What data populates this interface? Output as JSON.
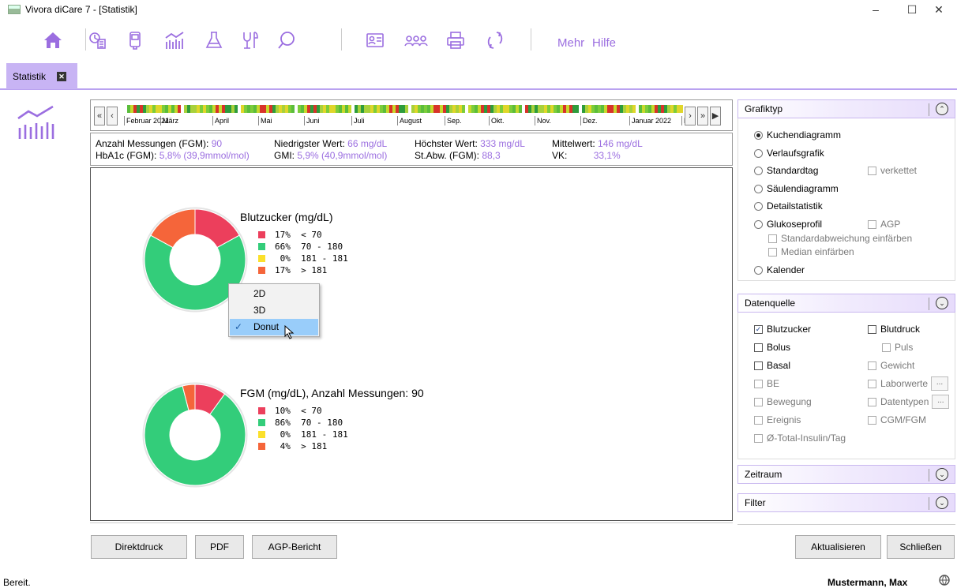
{
  "window": {
    "title": "Vivora diCare 7 - [Statistik]",
    "minimize": "–",
    "maximize": "☐",
    "close": "✕"
  },
  "toolbar": {
    "more_label": "Mehr",
    "help_label": "Hilfe"
  },
  "tab": {
    "label": "Statistik",
    "close": "✕"
  },
  "timeline": {
    "btn_first": "«",
    "btn_prev": "‹",
    "btn_next": "›",
    "btn_last": "»",
    "btn_play": "▶",
    "months": [
      "Februar 2021",
      "März",
      "April",
      "Mai",
      "Juni",
      "Juli",
      "August",
      "Sep.",
      "Okt.",
      "Nov.",
      "Dez.",
      "Januar 2022",
      "F"
    ]
  },
  "stats": {
    "count_label": "Anzahl Messungen (FGM):",
    "count_value": "90",
    "min_label": "Niedrigster Wert:",
    "min_value": "66 mg/dL",
    "max_label": "Höchster Wert:",
    "max_value": "333 mg/dL",
    "mean_label": "Mittelwert:",
    "mean_value": "146 mg/dL",
    "hba1c_label": "HbA1c (FGM):",
    "hba1c_value": "5,8% (39,9mmol/mol)",
    "gmi_label": "GMI:",
    "gmi_value": "5,9% (40,9mmol/mol)",
    "sd_label": "St.Abw. (FGM):",
    "sd_value": "88,3",
    "vk_label": "VK:",
    "vk_value": "33,1%"
  },
  "colors": {
    "red": "#ec3f5c",
    "green": "#33cd7a",
    "yellow": "#fbe02b",
    "orange": "#f5653a",
    "accent": "#9b6ee0"
  },
  "chart_data": [
    {
      "type": "pie",
      "title": "Blutzucker (mg/dL)",
      "categories": [
        "< 70",
        "70 - 180",
        "181 - 181",
        "> 181"
      ],
      "values": [
        17,
        66,
        0,
        17
      ],
      "legend": [
        "17%  < 70",
        "66%  70 - 180",
        " 0%  181 - 181",
        "17%  > 181"
      ]
    },
    {
      "type": "pie",
      "title": "FGM (mg/dL), Anzahl Messungen: 90",
      "categories": [
        "< 70",
        "70 - 180",
        "181 - 181",
        "> 181"
      ],
      "values": [
        10,
        86,
        0,
        4
      ],
      "legend": [
        "10%  < 70",
        "86%  70 - 180",
        " 0%  181 - 181",
        " 4%  > 181"
      ]
    }
  ],
  "context_menu": {
    "items": [
      "2D",
      "3D",
      "Donut"
    ],
    "check": "✓"
  },
  "panels": {
    "grafiktyp": {
      "title": "Grafiktyp",
      "toggle": "⌃",
      "options": [
        "Kuchendiagramm",
        "Verlaufsgrafik",
        "Standardtag",
        "Säulendiagramm",
        "Detailstatistik",
        "Glukoseprofil",
        "Kalender"
      ],
      "selected": "Kuchendiagramm",
      "verkettet": "verkettet",
      "agp": "AGP",
      "sd_color": "Standardabweichung einfärben",
      "median_color": "Median einfärben"
    },
    "datenquelle": {
      "title": "Datenquelle",
      "toggle": "⌄",
      "blutzucker": "Blutzucker",
      "blutdruck": "Blutdruck",
      "bolus": "Bolus",
      "puls": "Puls",
      "basal": "Basal",
      "gewicht": "Gewicht",
      "be": "BE",
      "laborwerte": "Laborwerte",
      "bewegung": "Bewegung",
      "datentypen": "Datentypen",
      "ereignis": "Ereignis",
      "cgm": "CGM/FGM",
      "total_insulin": "Ø-Total-Insulin/Tag",
      "check": "✓",
      "dots": "..."
    },
    "zeitraum": {
      "title": "Zeitraum",
      "toggle": "⌄"
    },
    "filter": {
      "title": "Filter",
      "toggle": "⌄"
    }
  },
  "buttons": {
    "direktdruck": "Direktdruck",
    "pdf": "PDF",
    "agp": "AGP-Bericht",
    "aktualisieren": "Aktualisieren",
    "schliessen": "Schließen"
  },
  "status": {
    "left": "Bereit.",
    "user": "Mustermann, Max"
  }
}
